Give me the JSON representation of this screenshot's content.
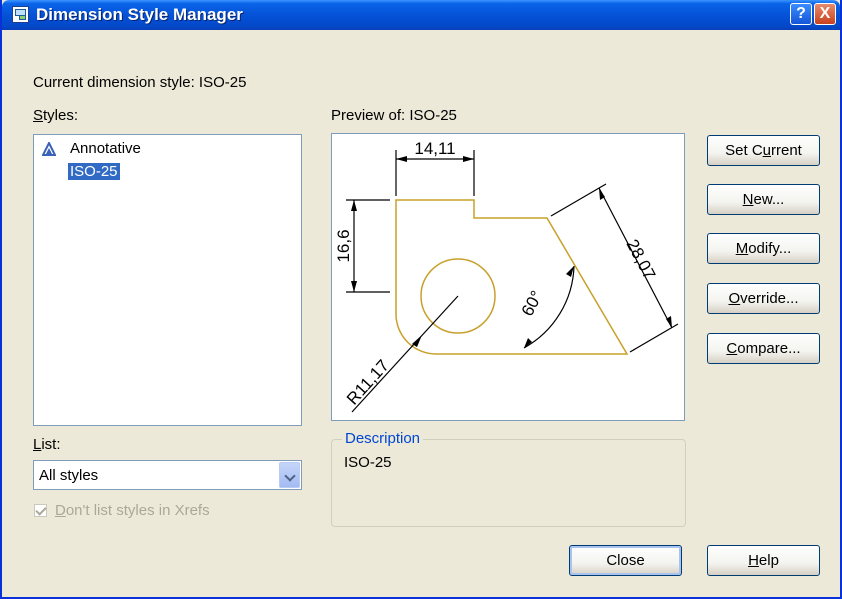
{
  "window": {
    "title": "Dimension Style Manager",
    "help_button": "?",
    "close_button": "X"
  },
  "current_style": {
    "label": "Current dimension style: ISO-25"
  },
  "styles": {
    "label_first": "S",
    "label_rest": "tyles:",
    "items": [
      {
        "label": "Annotative",
        "icon": "annotative-icon"
      },
      {
        "label": "ISO-25",
        "selected": true
      }
    ]
  },
  "preview": {
    "label": "Preview of: ISO-25",
    "dims": {
      "top_width": "14,11",
      "left_height": "16,6",
      "diagonal": "28,07",
      "angle": "60°",
      "radius": "R11,17"
    }
  },
  "description": {
    "legend": "Description",
    "text": "ISO-25"
  },
  "list": {
    "label_first": "L",
    "label_rest": "ist:",
    "selected": "All styles"
  },
  "xrefs_checkbox": {
    "label_first": "D",
    "label_rest": "on't list styles in Xrefs",
    "checked": true,
    "disabled": true
  },
  "buttons": {
    "set_current": {
      "before": "Set C",
      "key": "u",
      "after": "rrent"
    },
    "new": {
      "before": "",
      "key": "N",
      "after": "ew..."
    },
    "modify": {
      "before": "",
      "key": "M",
      "after": "odify..."
    },
    "override": {
      "before": "",
      "key": "O",
      "after": "verride..."
    },
    "compare": {
      "before": "",
      "key": "C",
      "after": "ompare..."
    },
    "close": {
      "label": "Close"
    },
    "help": {
      "before": "",
      "key": "H",
      "after": "elp"
    }
  },
  "colors": {
    "title_bar": "#0552d8",
    "dialog_bg": "#ece9d8",
    "selection": "#316ac5",
    "preview_geometry": "#c8a02a",
    "group_legend": "#0046d5"
  }
}
